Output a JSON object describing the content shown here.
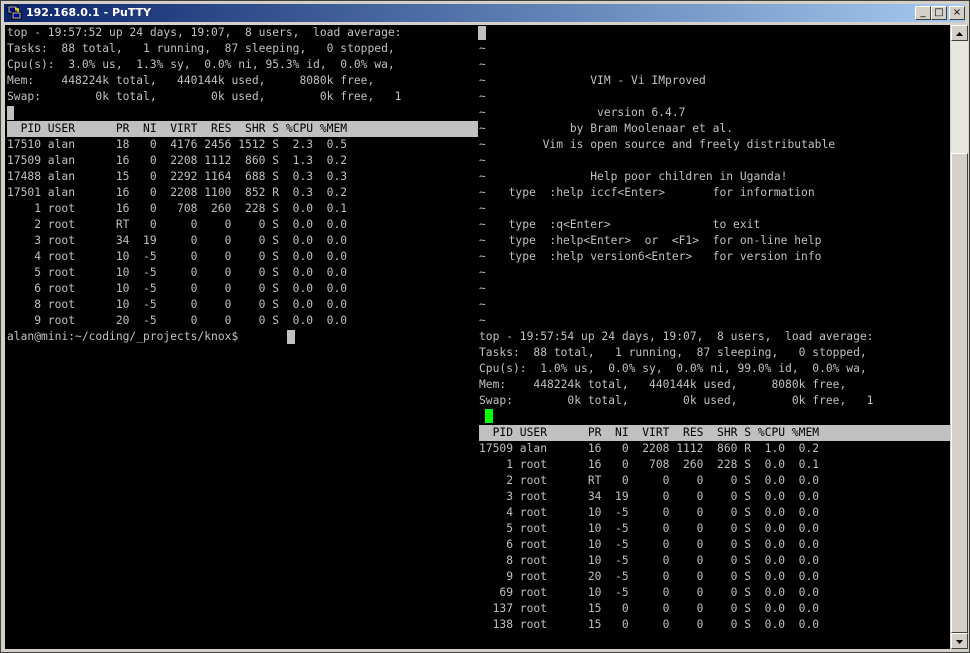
{
  "window": {
    "title": "192.168.0.1 - PuTTY",
    "btn_min": "_",
    "btn_max": "□",
    "btn_close": "×"
  },
  "left": {
    "summary": [
      "top - 19:57:52 up 24 days, 19:07,  8 users,  load average:",
      "Tasks:  88 total,   1 running,  87 sleeping,   0 stopped,",
      "Cpu(s):  3.0% us,  1.3% sy,  0.0% ni, 95.3% id,  0.0% wa,",
      "Mem:    448224k total,   440144k used,     8080k free,",
      "Swap:        0k total,        0k used,        0k free,   1"
    ],
    "header": "  PID USER      PR  NI  VIRT  RES  SHR S %CPU %MEM",
    "rows": [
      "17510 alan      18   0  4176 2456 1512 S  2.3  0.5",
      "17509 alan      16   0  2208 1112  860 S  1.3  0.2",
      "17488 alan      15   0  2292 1164  688 S  0.3  0.3",
      "17501 alan      16   0  2208 1100  852 R  0.3  0.2",
      "    1 root      16   0   708  260  228 S  0.0  0.1",
      "    2 root      RT   0     0    0    0 S  0.0  0.0",
      "    3 root      34  19     0    0    0 S  0.0  0.0",
      "    4 root      10  -5     0    0    0 S  0.0  0.0",
      "    5 root      10  -5     0    0    0 S  0.0  0.0",
      "    6 root      10  -5     0    0    0 S  0.0  0.0",
      "    8 root      10  -5     0    0    0 S  0.0  0.0",
      "    9 root      20  -5     0    0    0 S  0.0  0.0"
    ],
    "prompt": "alan@mini:~/coding/_projects/knox$ "
  },
  "vim": {
    "tilde": "~",
    "lines": [
      "",
      "",
      "              VIM - Vi IMproved",
      "",
      "               version 6.4.7",
      "           by Bram Moolenaar et al.",
      "       Vim is open source and freely distributable",
      "",
      "              Help poor children in Uganda!",
      "  type  :help iccf<Enter>       for information",
      "",
      "  type  :q<Enter>               to exit",
      "  type  :help<Enter>  or  <F1>  for on-line help",
      "  type  :help version6<Enter>   for version info",
      "",
      "",
      "",
      ""
    ]
  },
  "right": {
    "summary": [
      "top - 19:57:54 up 24 days, 19:07,  8 users,  load average:",
      "Tasks:  88 total,   1 running,  87 sleeping,   0 stopped,",
      "Cpu(s):  1.0% us,  0.0% sy,  0.0% ni, 99.0% id,  0.0% wa,",
      "Mem:    448224k total,   440144k used,     8080k free,",
      "Swap:        0k total,        0k used,        0k free,   1"
    ],
    "header": "  PID USER      PR  NI  VIRT  RES  SHR S %CPU %MEM",
    "rows": [
      "17509 alan      16   0  2208 1112  860 R  1.0  0.2",
      "    1 root      16   0   708  260  228 S  0.0  0.1",
      "    2 root      RT   0     0    0    0 S  0.0  0.0",
      "    3 root      34  19     0    0    0 S  0.0  0.0",
      "    4 root      10  -5     0    0    0 S  0.0  0.0",
      "    5 root      10  -5     0    0    0 S  0.0  0.0",
      "    6 root      10  -5     0    0    0 S  0.0  0.0",
      "    8 root      10  -5     0    0    0 S  0.0  0.0",
      "    9 root      20  -5     0    0    0 S  0.0  0.0",
      "   69 root      10  -5     0    0    0 S  0.0  0.0",
      "  137 root      15   0     0    0    0 S  0.0  0.0",
      "  138 root      15   0     0    0    0 S  0.0  0.0"
    ]
  },
  "colors": {
    "terminal_bg": "#000000",
    "terminal_fg": "#c0c0c0",
    "header_bg": "#c0c0c0",
    "cursor_active": "#00ff00"
  }
}
